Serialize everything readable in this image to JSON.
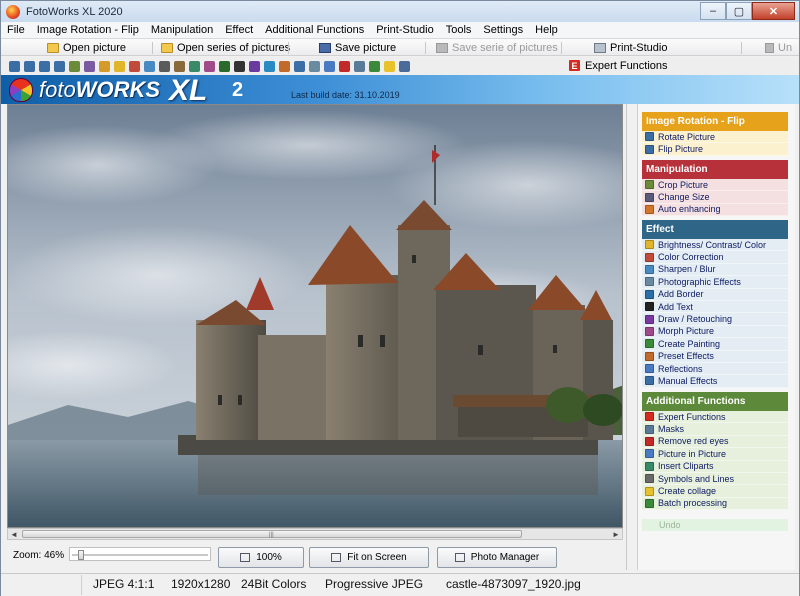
{
  "window": {
    "title": "FotoWorks XL 2020",
    "controls": {
      "minimize": "–",
      "maximize": "▢",
      "close": "✕"
    }
  },
  "menu": [
    "File",
    "Image Rotation - Flip",
    "Manipulation",
    "Effect",
    "Additional Functions",
    "Print-Studio",
    "Tools",
    "Settings",
    "Help"
  ],
  "quickbar": {
    "open_picture": "Open picture",
    "open_series": "Open series of pictures",
    "save_picture": "Save picture",
    "save_series": "Save serie of pictures",
    "print_studio": "Print-Studio",
    "undo": "Un"
  },
  "toolbar": {
    "tool_icons": [
      "rotate-left-icon",
      "rotate-right-icon",
      "flip-icon",
      "mirror-icon",
      "crop-icon",
      "resize-icon",
      "auto-enhance-icon",
      "brightness-icon",
      "color-icon",
      "sharpen-icon",
      "scissors-icon",
      "frame-icon",
      "pencil-icon",
      "retouch-icon",
      "paint-icon",
      "text-icon",
      "draw-icon",
      "bucket-icon",
      "effects-icon",
      "collage-icon",
      "picture-in-picture-icon",
      "clipart-icon",
      "red-eye-icon",
      "mask-icon",
      "batch-icon",
      "star-icon",
      "print-icon"
    ],
    "tool_colors": [
      "#3a6ea5",
      "#3a6ea5",
      "#3a6ea5",
      "#3a6ea5",
      "#6b8a3a",
      "#7a5aa0",
      "#d49a2a",
      "#e0b52a",
      "#c24a3a",
      "#4a8ac2",
      "#5a5a5a",
      "#8a6a3a",
      "#3a8a6a",
      "#a04a8a",
      "#2a6a2a",
      "#333333",
      "#6a3aa0",
      "#2a8ac2",
      "#c26a2a",
      "#3a6ea5",
      "#6a8aa0",
      "#4a7ac2",
      "#c22a2a",
      "#5a7a9a",
      "#3a8a3a",
      "#e8c22a",
      "#4a6a9a"
    ],
    "expert_badge": "E",
    "expert_label": "Expert Functions"
  },
  "banner": {
    "logo_foto": "foto",
    "logo_works": "WORKS",
    "logo_xl": "XL",
    "logo_version": "2",
    "build_date": "Last build date: 31.10.2019"
  },
  "zoom": {
    "label": "Zoom: 46%",
    "value_percent": 46
  },
  "buttons": {
    "zoom_100": "100%",
    "fit_screen": "Fit on Screen",
    "photo_manager": "Photo Manager"
  },
  "status": {
    "format": "JPEG  4:1:1",
    "dimensions": "1920x1280",
    "colors": "24Bit Colors",
    "encoding": "Progressive JPEG",
    "filename": "castle-4873097_1920.jpg"
  },
  "panel": {
    "sections": [
      {
        "title": "Image Rotation - Flip",
        "color": "#e5a21a",
        "item_bg": "#fbf1cf",
        "items": [
          {
            "label": "Rotate Picture",
            "icon": "rotate-icon",
            "icon_color": "#3a6ea5"
          },
          {
            "label": "Flip Picture",
            "icon": "flip-icon",
            "icon_color": "#3a6ea5"
          }
        ]
      },
      {
        "title": "Manipulation",
        "color": "#b7313a",
        "item_bg": "#f4e0e0",
        "items": [
          {
            "label": "Crop Picture",
            "icon": "crop-icon",
            "icon_color": "#6b8a3a"
          },
          {
            "label": "Change Size",
            "icon": "resize-icon",
            "icon_color": "#5a5a7a"
          },
          {
            "label": "Auto enhancing",
            "icon": "auto-enhance-icon",
            "icon_color": "#d4762a"
          }
        ]
      },
      {
        "title": "Effect",
        "color": "#2f6688",
        "item_bg": "#e3edf3",
        "items": [
          {
            "label": "Brightness/ Contrast/ Color",
            "icon": "brightness-icon",
            "icon_color": "#e0b52a"
          },
          {
            "label": "Color Correction",
            "icon": "color-correction-icon",
            "icon_color": "#c24a3a"
          },
          {
            "label": "Sharpen / Blur",
            "icon": "sharpen-icon",
            "icon_color": "#4a8ac2"
          },
          {
            "label": "Photographic Effects",
            "icon": "photo-effects-icon",
            "icon_color": "#6a8aa0"
          },
          {
            "label": "Add Border",
            "icon": "border-icon",
            "icon_color": "#2a6ea5"
          },
          {
            "label": "Add Text",
            "icon": "text-icon",
            "icon_color": "#222222"
          },
          {
            "label": "Draw / Retouching",
            "icon": "draw-icon",
            "icon_color": "#7a3aa0"
          },
          {
            "label": "Morph Picture",
            "icon": "morph-icon",
            "icon_color": "#a04a8a"
          },
          {
            "label": "Create Painting",
            "icon": "painting-icon",
            "icon_color": "#3a8a3a"
          },
          {
            "label": "Preset Effects",
            "icon": "preset-icon",
            "icon_color": "#c26a2a"
          },
          {
            "label": "Reflections",
            "icon": "reflection-icon",
            "icon_color": "#4a7ac2"
          },
          {
            "label": "Manual Effects",
            "icon": "manual-effects-icon",
            "icon_color": "#3a6ea5"
          }
        ]
      },
      {
        "title": "Additional Functions",
        "color": "#5c8a3a",
        "item_bg": "#e6f0dc",
        "items": [
          {
            "label": "Expert Functions",
            "icon": "expert-icon",
            "icon_color": "#d42a1f"
          },
          {
            "label": "Masks",
            "icon": "mask-icon",
            "icon_color": "#5a7a9a"
          },
          {
            "label": "Remove red eyes",
            "icon": "red-eye-icon",
            "icon_color": "#c22a2a"
          },
          {
            "label": "Picture in Picture",
            "icon": "picture-in-picture-icon",
            "icon_color": "#4a7ac2"
          },
          {
            "label": "Insert Cliparts",
            "icon": "clipart-icon",
            "icon_color": "#3a8a6a"
          },
          {
            "label": "Symbols and Lines",
            "icon": "symbols-icon",
            "icon_color": "#6a6a6a"
          },
          {
            "label": "Create collage",
            "icon": "collage-icon",
            "icon_color": "#e8c22a"
          },
          {
            "label": "Batch processing",
            "icon": "batch-icon",
            "icon_color": "#3a8a3a"
          }
        ]
      }
    ],
    "undo_label": "Undo"
  },
  "colors": {
    "title_gradient": "#c9dbee",
    "banner_blue": "#0f5ea8",
    "selected_link": "#0d1a63"
  }
}
